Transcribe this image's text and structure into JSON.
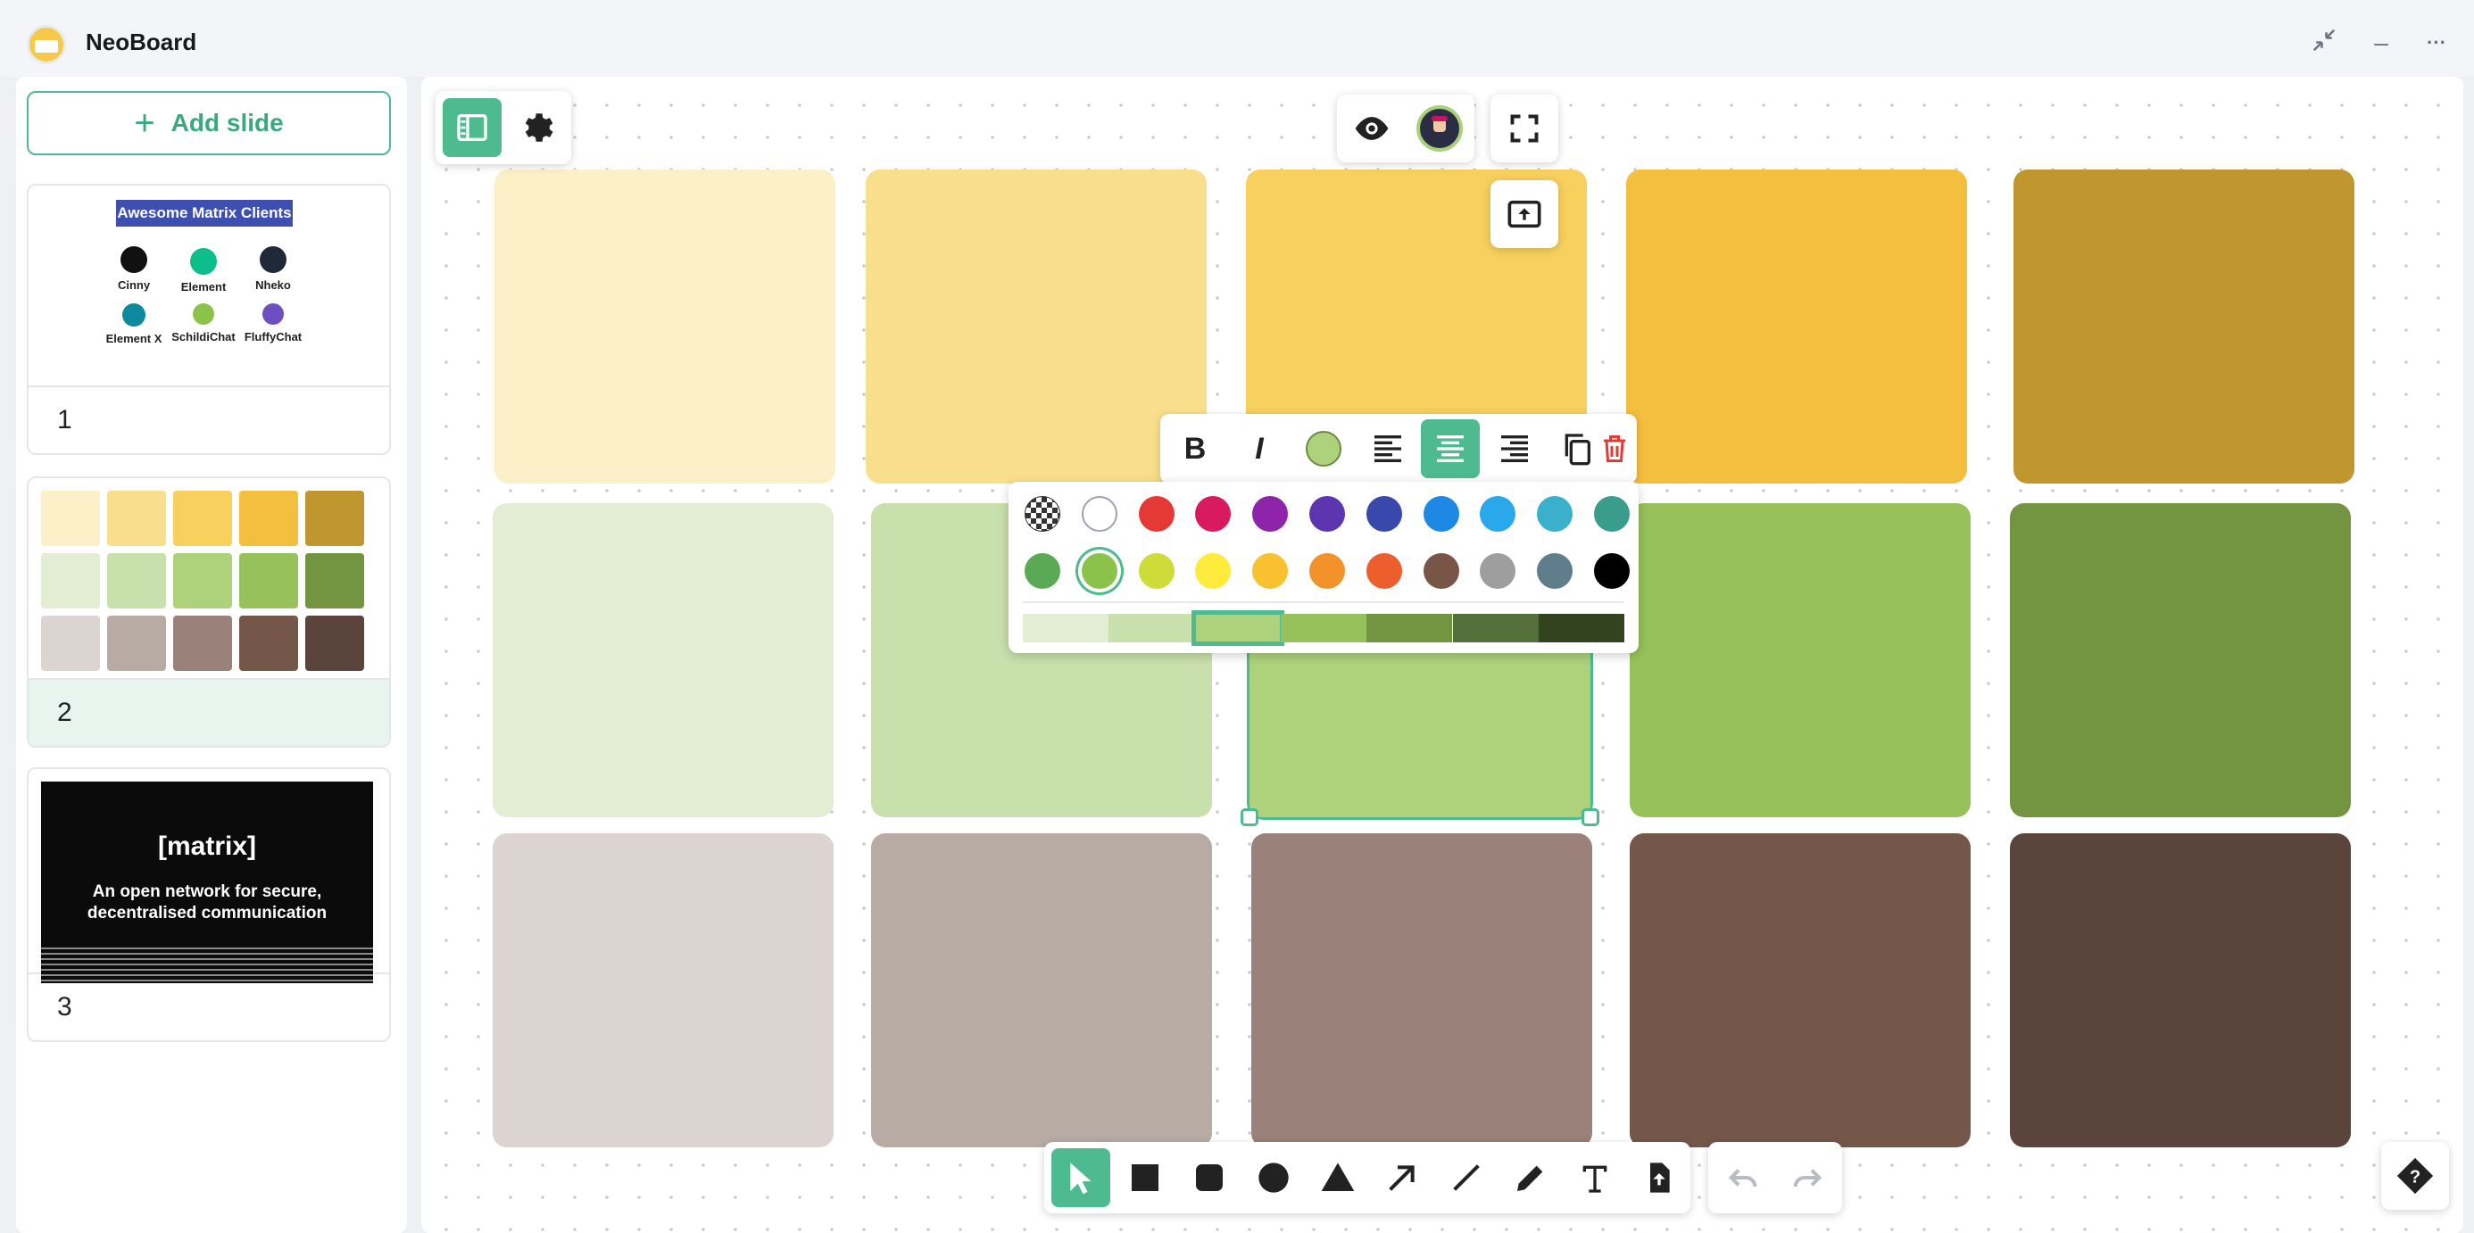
{
  "app": {
    "title": "NeoBoard"
  },
  "window_controls": {
    "collapse_icon": "collapse-arrows-icon",
    "minimize": "–",
    "more": "···"
  },
  "sidebar": {
    "add_slide_label": "Add slide",
    "slides": [
      {
        "number": "1",
        "thumbnail": {
          "title": "Awesome Matrix Clients",
          "clients": [
            {
              "name": "Cinny",
              "color": "#111111"
            },
            {
              "name": "Element",
              "color": "#0dbd8b"
            },
            {
              "name": "Nheko",
              "color": "#1f2937"
            },
            {
              "name": "Element X",
              "color": "#0d8a9e"
            },
            {
              "name": "SchildiChat",
              "color": "#8bc34a"
            },
            {
              "name": "FluffyChat",
              "color": "#6d4fc2"
            }
          ]
        }
      },
      {
        "number": "2",
        "active": true
      },
      {
        "number": "3",
        "thumbnail": {
          "logo": "[matrix]",
          "subtitle_line1": "An open network for secure,",
          "subtitle_line2": "decentralised communication"
        }
      }
    ]
  },
  "palette": {
    "rows": [
      [
        "#fbf0c8",
        "#f9df8c",
        "#f7d05d",
        "#f4be3f",
        "#c0962f"
      ],
      [
        "#e2edd4",
        "#c8e0ab",
        "#aed17b",
        "#97c15a",
        "#739541"
      ],
      [
        "#dcd4d1",
        "#b8aba4",
        "#9a827a",
        "#75574a",
        "#5b443b"
      ]
    ],
    "selected": {
      "row": 1,
      "col": 2
    }
  },
  "text_toolbar": {
    "bold": "B",
    "italic": "I",
    "color_value": "#aed17b",
    "alignment": "center"
  },
  "color_picker": {
    "colors_row1": [
      "transparent",
      "#ffffff",
      "#e53935",
      "#d81b60",
      "#8e24aa",
      "#5e35b1",
      "#3949ab",
      "#1e88e5",
      "#29a8ec",
      "#3bb0cd",
      "#3a9c8b"
    ],
    "colors_row2": [
      "#5aaa55",
      "#8bc34a",
      "#cddc39",
      "#ffeb3b",
      "#f9c02f",
      "#f3922a",
      "#ec5e2c",
      "#795548",
      "#9e9e9e",
      "#607d8b",
      "#000000"
    ],
    "selected_color": "#8bc34a",
    "shades": [
      "#e2edd4",
      "#c8e0ab",
      "#aed17b",
      "#97c15a",
      "#739541",
      "#55703a",
      "#33421f"
    ],
    "selected_shade": 2
  },
  "right_controls": {
    "view": "eye-icon",
    "avatar": "user-avatar",
    "fullscreen": "fullscreen-icon",
    "present": "present-icon"
  },
  "draw_tools": [
    "select",
    "rectangle",
    "rounded-rectangle",
    "circle",
    "triangle",
    "arrow",
    "line",
    "pencil",
    "text",
    "upload"
  ],
  "help_icon": "help-icon"
}
